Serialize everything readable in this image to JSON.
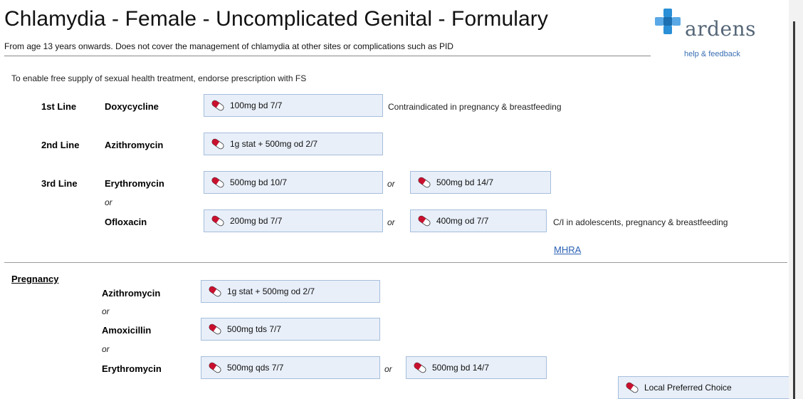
{
  "header": {
    "title": "Chlamydia - Female - Uncomplicated Genital - Formulary",
    "subtitle": "From age 13 years onwards. Does not cover the management of chlamydia at other sites or complications such as PID",
    "brand": "ardens",
    "help_link": "help & feedback"
  },
  "note": "To enable free supply of sexual health treatment, endorse prescription with FS",
  "lines": {
    "first": {
      "label": "1st Line",
      "drug": "Doxycycline",
      "dose": "100mg bd 7/7",
      "info": "Contraindicated in pregnancy & breastfeeding"
    },
    "second": {
      "label": "2nd Line",
      "drug": "Azithromycin",
      "dose": "1g stat + 500mg od 2/7"
    },
    "third": {
      "label": "3rd Line",
      "drug_a": "Erythromycin",
      "dose_a1": "500mg bd 10/7",
      "dose_a2": "500mg bd 14/7",
      "or_between": "or",
      "drug_b": "Ofloxacin",
      "dose_b1": "200mg bd 7/7",
      "dose_b2": "400mg od 7/7",
      "info_b": "C/I in adolescents, pregnancy & breastfeeding",
      "link": "MHRA"
    },
    "or_word": "or"
  },
  "pregnancy": {
    "heading": "Pregnancy",
    "drug_1": "Azithromycin",
    "dose_1": "1g stat + 500mg od 2/7",
    "drug_2": "Amoxicillin",
    "dose_2": "500mg tds 7/7",
    "drug_3": "Erythromycin",
    "dose_3a": "500mg qds 7/7",
    "dose_3b": "500mg bd 14/7"
  },
  "legend": {
    "label": "Local Preferred Choice"
  },
  "colors": {
    "dose_bg": "#e8eff9",
    "dose_border": "#a6bedc",
    "pill_red": "#c8102e",
    "brand_blue": "#2a8fd6",
    "link_blue": "#2a5fb3"
  },
  "icons": {
    "dose": "pill-icon",
    "logo": "medical-cross-icon"
  }
}
